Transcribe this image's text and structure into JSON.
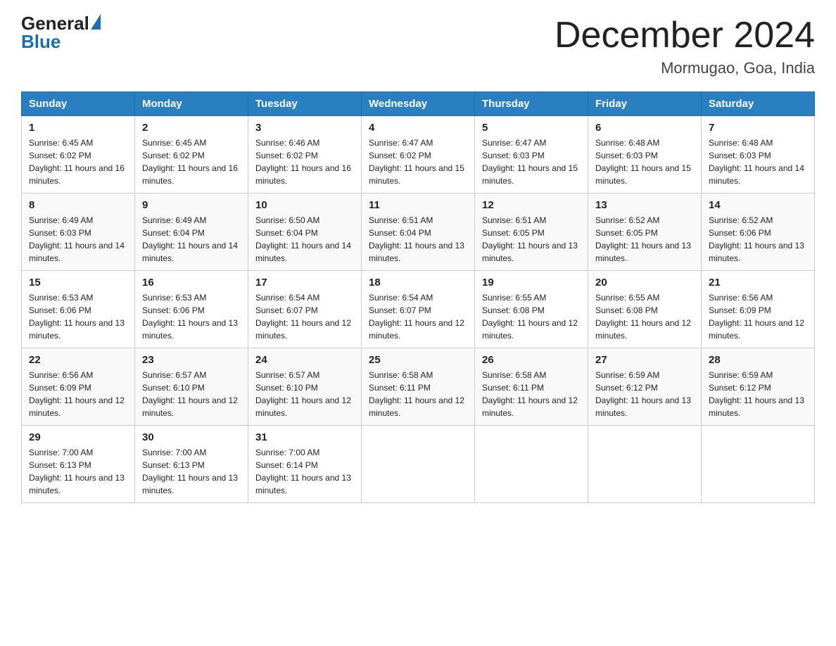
{
  "header": {
    "month_title": "December 2024",
    "location": "Mormugao, Goa, India",
    "logo_general": "General",
    "logo_blue": "Blue"
  },
  "days_of_week": [
    "Sunday",
    "Monday",
    "Tuesday",
    "Wednesday",
    "Thursday",
    "Friday",
    "Saturday"
  ],
  "weeks": [
    [
      {
        "day": "1",
        "sunrise": "6:45 AM",
        "sunset": "6:02 PM",
        "daylight": "11 hours and 16 minutes."
      },
      {
        "day": "2",
        "sunrise": "6:45 AM",
        "sunset": "6:02 PM",
        "daylight": "11 hours and 16 minutes."
      },
      {
        "day": "3",
        "sunrise": "6:46 AM",
        "sunset": "6:02 PM",
        "daylight": "11 hours and 16 minutes."
      },
      {
        "day": "4",
        "sunrise": "6:47 AM",
        "sunset": "6:02 PM",
        "daylight": "11 hours and 15 minutes."
      },
      {
        "day": "5",
        "sunrise": "6:47 AM",
        "sunset": "6:03 PM",
        "daylight": "11 hours and 15 minutes."
      },
      {
        "day": "6",
        "sunrise": "6:48 AM",
        "sunset": "6:03 PM",
        "daylight": "11 hours and 15 minutes."
      },
      {
        "day": "7",
        "sunrise": "6:48 AM",
        "sunset": "6:03 PM",
        "daylight": "11 hours and 14 minutes."
      }
    ],
    [
      {
        "day": "8",
        "sunrise": "6:49 AM",
        "sunset": "6:03 PM",
        "daylight": "11 hours and 14 minutes."
      },
      {
        "day": "9",
        "sunrise": "6:49 AM",
        "sunset": "6:04 PM",
        "daylight": "11 hours and 14 minutes."
      },
      {
        "day": "10",
        "sunrise": "6:50 AM",
        "sunset": "6:04 PM",
        "daylight": "11 hours and 14 minutes."
      },
      {
        "day": "11",
        "sunrise": "6:51 AM",
        "sunset": "6:04 PM",
        "daylight": "11 hours and 13 minutes."
      },
      {
        "day": "12",
        "sunrise": "6:51 AM",
        "sunset": "6:05 PM",
        "daylight": "11 hours and 13 minutes."
      },
      {
        "day": "13",
        "sunrise": "6:52 AM",
        "sunset": "6:05 PM",
        "daylight": "11 hours and 13 minutes."
      },
      {
        "day": "14",
        "sunrise": "6:52 AM",
        "sunset": "6:06 PM",
        "daylight": "11 hours and 13 minutes."
      }
    ],
    [
      {
        "day": "15",
        "sunrise": "6:53 AM",
        "sunset": "6:06 PM",
        "daylight": "11 hours and 13 minutes."
      },
      {
        "day": "16",
        "sunrise": "6:53 AM",
        "sunset": "6:06 PM",
        "daylight": "11 hours and 13 minutes."
      },
      {
        "day": "17",
        "sunrise": "6:54 AM",
        "sunset": "6:07 PM",
        "daylight": "11 hours and 12 minutes."
      },
      {
        "day": "18",
        "sunrise": "6:54 AM",
        "sunset": "6:07 PM",
        "daylight": "11 hours and 12 minutes."
      },
      {
        "day": "19",
        "sunrise": "6:55 AM",
        "sunset": "6:08 PM",
        "daylight": "11 hours and 12 minutes."
      },
      {
        "day": "20",
        "sunrise": "6:55 AM",
        "sunset": "6:08 PM",
        "daylight": "11 hours and 12 minutes."
      },
      {
        "day": "21",
        "sunrise": "6:56 AM",
        "sunset": "6:09 PM",
        "daylight": "11 hours and 12 minutes."
      }
    ],
    [
      {
        "day": "22",
        "sunrise": "6:56 AM",
        "sunset": "6:09 PM",
        "daylight": "11 hours and 12 minutes."
      },
      {
        "day": "23",
        "sunrise": "6:57 AM",
        "sunset": "6:10 PM",
        "daylight": "11 hours and 12 minutes."
      },
      {
        "day": "24",
        "sunrise": "6:57 AM",
        "sunset": "6:10 PM",
        "daylight": "11 hours and 12 minutes."
      },
      {
        "day": "25",
        "sunrise": "6:58 AM",
        "sunset": "6:11 PM",
        "daylight": "11 hours and 12 minutes."
      },
      {
        "day": "26",
        "sunrise": "6:58 AM",
        "sunset": "6:11 PM",
        "daylight": "11 hours and 12 minutes."
      },
      {
        "day": "27",
        "sunrise": "6:59 AM",
        "sunset": "6:12 PM",
        "daylight": "11 hours and 13 minutes."
      },
      {
        "day": "28",
        "sunrise": "6:59 AM",
        "sunset": "6:12 PM",
        "daylight": "11 hours and 13 minutes."
      }
    ],
    [
      {
        "day": "29",
        "sunrise": "7:00 AM",
        "sunset": "6:13 PM",
        "daylight": "11 hours and 13 minutes."
      },
      {
        "day": "30",
        "sunrise": "7:00 AM",
        "sunset": "6:13 PM",
        "daylight": "11 hours and 13 minutes."
      },
      {
        "day": "31",
        "sunrise": "7:00 AM",
        "sunset": "6:14 PM",
        "daylight": "11 hours and 13 minutes."
      },
      null,
      null,
      null,
      null
    ]
  ]
}
